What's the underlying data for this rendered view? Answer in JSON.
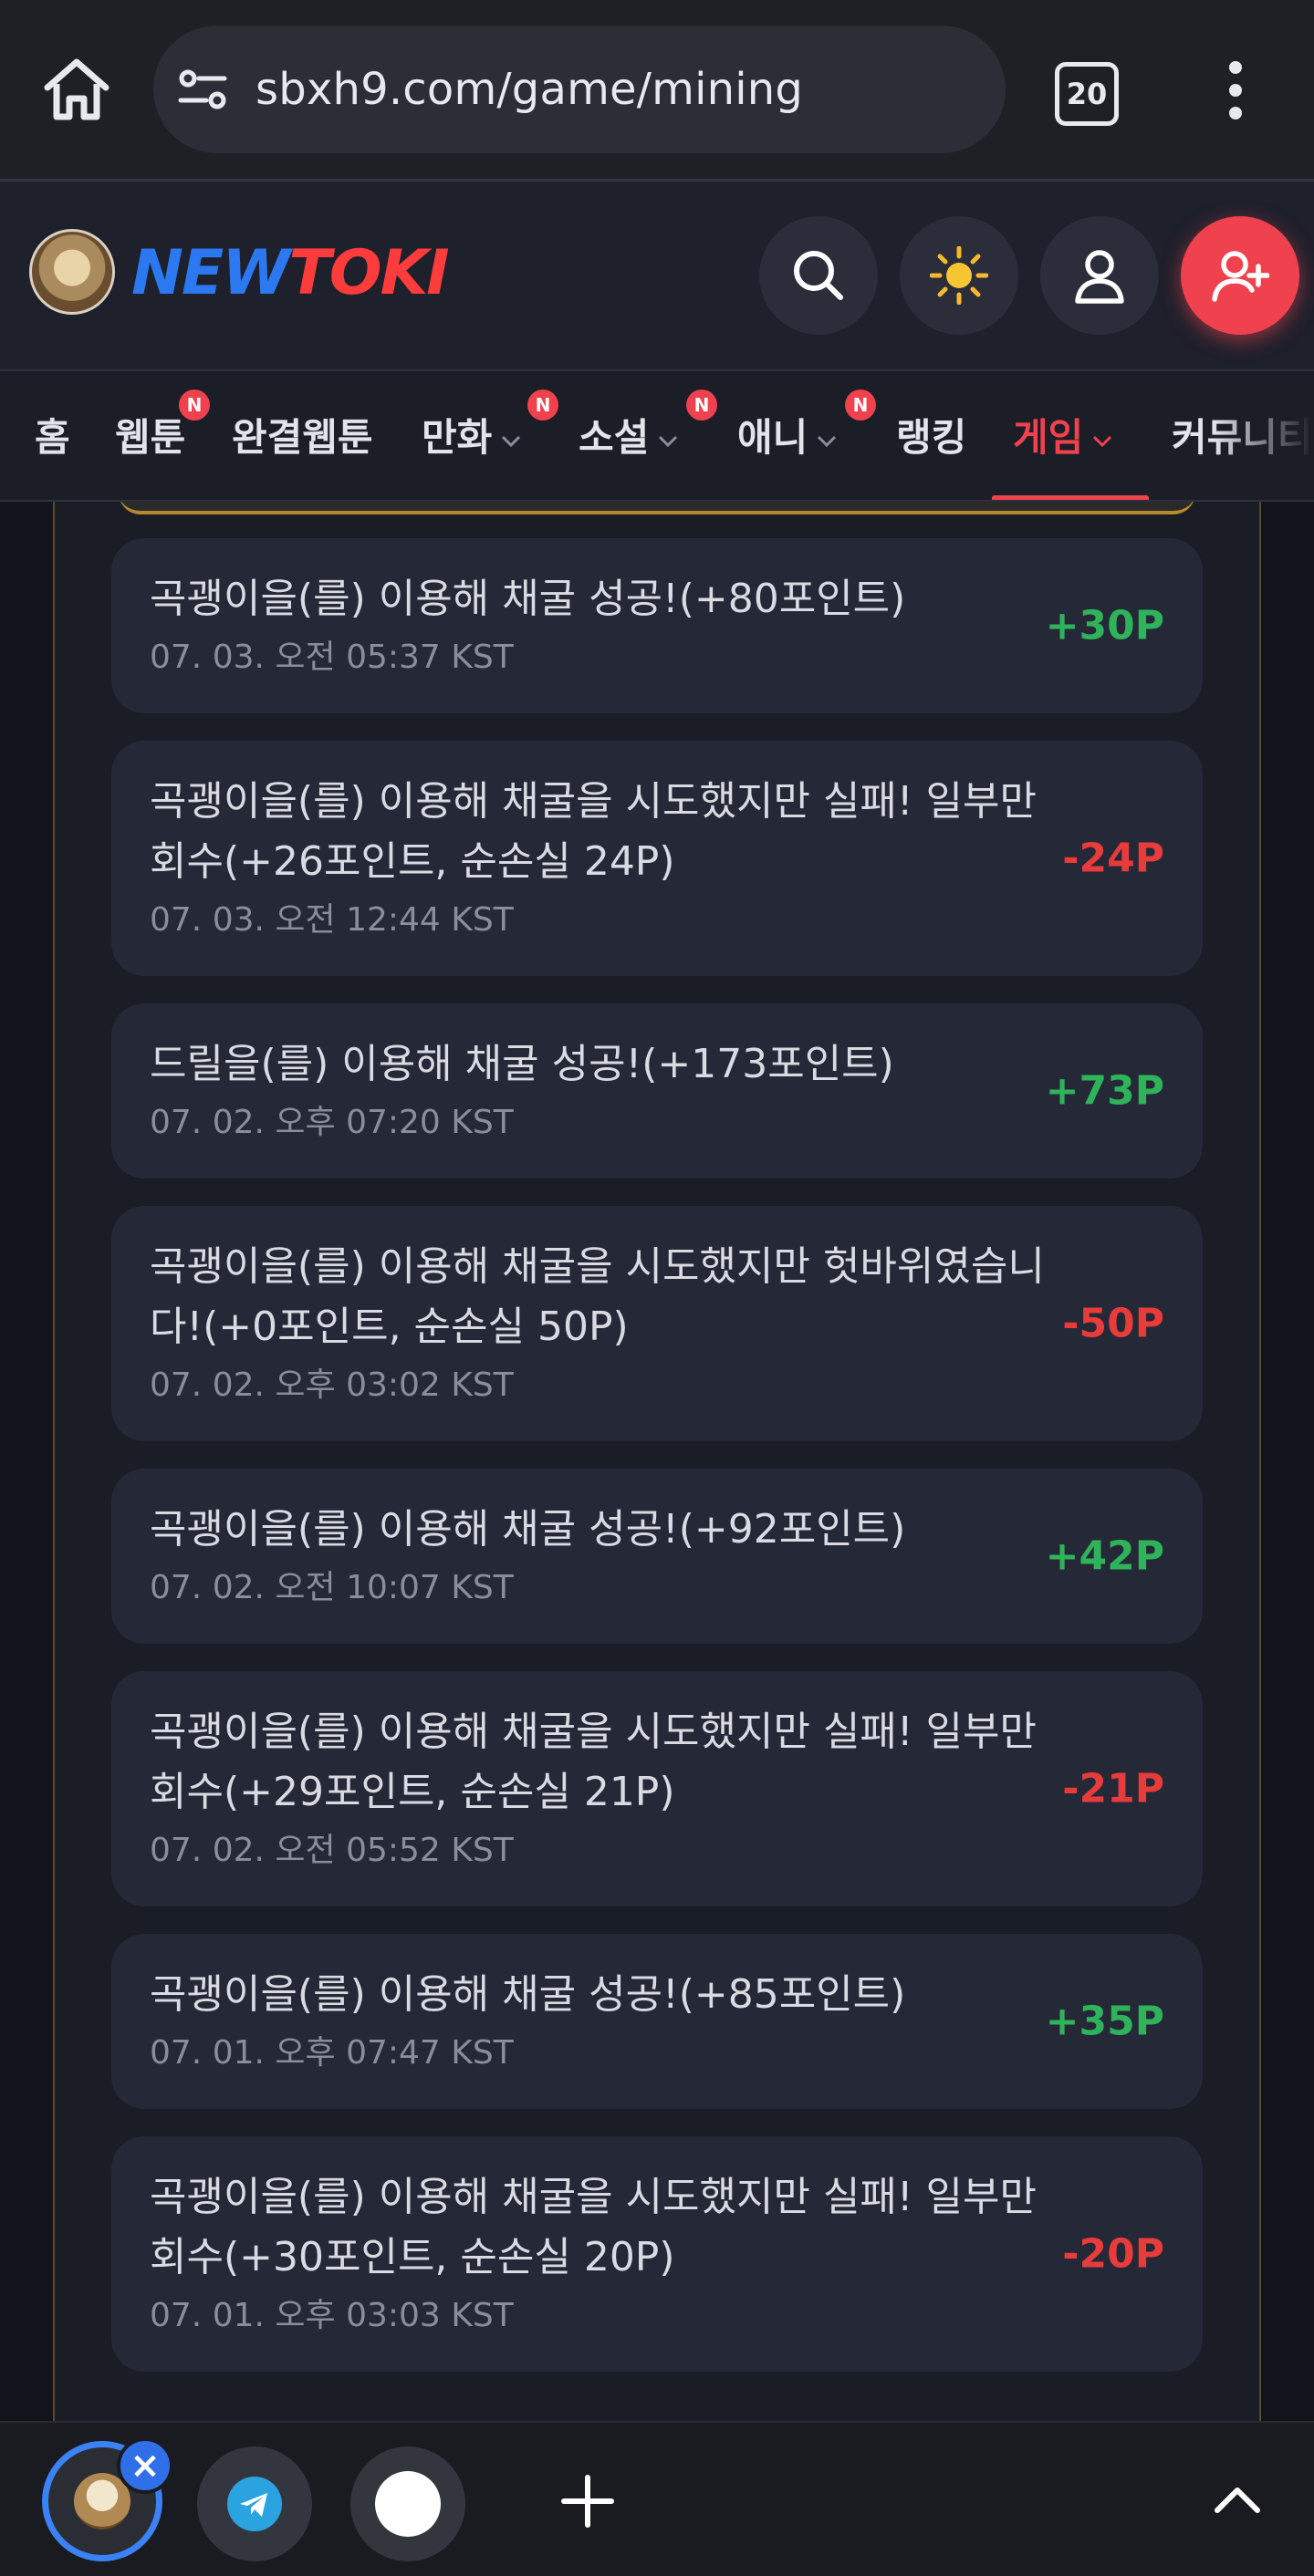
{
  "browser": {
    "url": "sbxh9.com/game/mining",
    "tab_count": "20"
  },
  "site": {
    "logo_new": "NEW",
    "logo_toki": "TOKI"
  },
  "nav": {
    "items": [
      {
        "label": "홈",
        "badge": ""
      },
      {
        "label": "웹툰",
        "badge": "N"
      },
      {
        "label": "완결웹툰",
        "badge": ""
      },
      {
        "label": "만화",
        "badge": "N"
      },
      {
        "label": "소설",
        "badge": "N"
      },
      {
        "label": "애니",
        "badge": "N"
      },
      {
        "label": "랭킹",
        "badge": ""
      },
      {
        "label": "게임",
        "badge": ""
      },
      {
        "label": "커뮤니티",
        "badge": ""
      }
    ],
    "active": "게임"
  },
  "log": {
    "items": [
      {
        "message": "곡괭이을(를) 이용해 채굴 성공!(+80포인트)",
        "time": "07. 03. 오전 05:37 KST",
        "delta": "+30P",
        "type": "pos"
      },
      {
        "message": "곡괭이을(를) 이용해 채굴을 시도했지만 실패! 일부만 회수(+26포인트, 순손실 24P)",
        "time": "07. 03. 오전 12:44 KST",
        "delta": "-24P",
        "type": "neg"
      },
      {
        "message": "드릴을(를) 이용해 채굴 성공!(+173포인트)",
        "time": "07. 02. 오후 07:20 KST",
        "delta": "+73P",
        "type": "pos"
      },
      {
        "message": "곡괭이을(를) 이용해 채굴을 시도했지만 헛바위였습니다!(+0포인트, 순손실 50P)",
        "time": "07. 02. 오후 03:02 KST",
        "delta": "-50P",
        "type": "neg"
      },
      {
        "message": "곡괭이을(를) 이용해 채굴 성공!(+92포인트)",
        "time": "07. 02. 오전 10:07 KST",
        "delta": "+42P",
        "type": "pos"
      },
      {
        "message": "곡괭이을(를) 이용해 채굴을 시도했지만 실패! 일부만 회수(+29포인트, 순손실 21P)",
        "time": "07. 02. 오전 05:52 KST",
        "delta": "-21P",
        "type": "neg"
      },
      {
        "message": "곡괭이을(를) 이용해 채굴 성공!(+85포인트)",
        "time": "07. 01. 오후 07:47 KST",
        "delta": "+35P",
        "type": "pos"
      },
      {
        "message": "곡괭이을(를) 이용해 채굴을 시도했지만 실패! 일부만 회수(+30포인트, 순손실 20P)",
        "time": "07. 01. 오후 03:03 KST",
        "delta": "-20P",
        "type": "neg"
      }
    ]
  },
  "icons": {
    "home": "home-icon",
    "site_info": "site-settings-icon",
    "menu": "more-vert-icon",
    "search": "search-icon",
    "theme": "sun-icon",
    "profile": "user-icon",
    "join": "user-plus-icon",
    "new_tab": "plus-icon",
    "expand": "chevron-up-icon"
  },
  "colors": {
    "accent": "#f0414e",
    "positive": "#2fb35a",
    "negative": "#e83b3b",
    "brand_new": "#2b78f0",
    "brand_toki": "#ff3c3c"
  }
}
